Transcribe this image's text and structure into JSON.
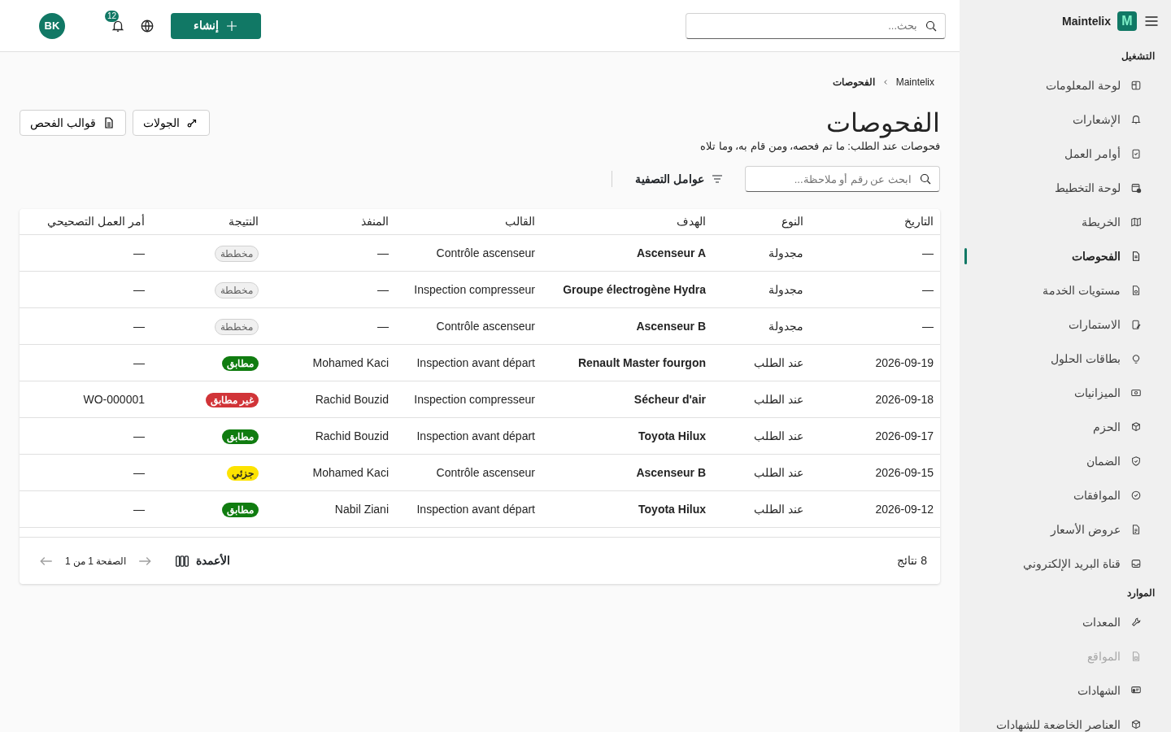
{
  "sidebar": {
    "brand": "Maintelix",
    "logo_letter": "M",
    "sections": [
      {
        "title": "التشغيل",
        "items": [
          {
            "label": "لوحة المعلومات",
            "selected": false,
            "disabled": false
          },
          {
            "label": "الإشعارات",
            "selected": false,
            "disabled": false
          },
          {
            "label": "أوامر العمل",
            "selected": false,
            "disabled": false
          },
          {
            "label": "لوحة التخطيط",
            "selected": false,
            "disabled": false
          },
          {
            "label": "الخريطة",
            "selected": false,
            "disabled": false
          },
          {
            "label": "الفحوصات",
            "selected": true,
            "disabled": false
          },
          {
            "label": "مستويات الخدمة",
            "selected": false,
            "disabled": false
          },
          {
            "label": "الاستمارات",
            "selected": false,
            "disabled": false
          },
          {
            "label": "بطاقات الحلول",
            "selected": false,
            "disabled": false
          },
          {
            "label": "الميزانيات",
            "selected": false,
            "disabled": false
          },
          {
            "label": "الحزم",
            "selected": false,
            "disabled": false
          },
          {
            "label": "الضمان",
            "selected": false,
            "disabled": false
          },
          {
            "label": "الموافقات",
            "selected": false,
            "disabled": false
          },
          {
            "label": "عروض الأسعار",
            "selected": false,
            "disabled": false
          },
          {
            "label": "قناة البريد الإلكتروني",
            "selected": false,
            "disabled": false
          }
        ]
      },
      {
        "title": "الموارد",
        "items": [
          {
            "label": "المعدات",
            "selected": false,
            "disabled": false
          },
          {
            "label": "المواقع",
            "selected": false,
            "disabled": true
          },
          {
            "label": "الشهادات",
            "selected": false,
            "disabled": false
          },
          {
            "label": "العناصر الخاضعة للشهادات",
            "selected": false,
            "disabled": false
          }
        ]
      }
    ]
  },
  "header": {
    "search": {
      "placeholder": "بحث..."
    },
    "create_button": "إنشاء",
    "notifications_count": "12",
    "avatar": "BK"
  },
  "breadcrumb": [
    "Maintelix",
    "الفحوصات"
  ],
  "title": "الفحوصات",
  "description": "فحوصات عند الطلب: ما تم فحصه، ومن قام به، وما تلاه",
  "actions": [
    "الجولات",
    "قوالب الفحص"
  ],
  "toolbar": {
    "search": {
      "placeholder": "ابحث عن رقم أو ملاحظة..."
    },
    "filters_button": "عوامل التصفية"
  },
  "table": {
    "columns": [
      "التاريخ",
      "النوع",
      "الهدف",
      "القالب",
      "المنفذ",
      "النتيجة",
      "أمر العمل التصحيحي"
    ],
    "rows": [
      {
        "date": "—",
        "type": "مجدولة",
        "target": "Ascenseur A",
        "template": "Contrôle ascenseur",
        "executor": "—",
        "result": {
          "label": "مخططة",
          "kind": "planned"
        },
        "work_order": "—"
      },
      {
        "date": "—",
        "type": "مجدولة",
        "target": "Groupe électrogène Hydra",
        "template": "Inspection compresseur",
        "executor": "—",
        "result": {
          "label": "مخططة",
          "kind": "planned"
        },
        "work_order": "—"
      },
      {
        "date": "—",
        "type": "مجدولة",
        "target": "Ascenseur B",
        "template": "Contrôle ascenseur",
        "executor": "—",
        "result": {
          "label": "مخططة",
          "kind": "planned"
        },
        "work_order": "—"
      },
      {
        "date": "2026-09-19",
        "type": "عند الطلب",
        "target": "Renault Master fourgon",
        "template": "Inspection avant départ",
        "executor": "Mohamed Kaci",
        "result": {
          "label": "مطابق",
          "kind": "pass"
        },
        "work_order": "—"
      },
      {
        "date": "2026-09-18",
        "type": "عند الطلب",
        "target": "Sécheur d'air",
        "template": "Inspection compresseur",
        "executor": "Rachid Bouzid",
        "result": {
          "label": "غير مطابق",
          "kind": "fail"
        },
        "work_order": "WO-000001"
      },
      {
        "date": "2026-09-17",
        "type": "عند الطلب",
        "target": "Toyota Hilux",
        "template": "Inspection avant départ",
        "executor": "Rachid Bouzid",
        "result": {
          "label": "مطابق",
          "kind": "pass"
        },
        "work_order": "—"
      },
      {
        "date": "2026-09-15",
        "type": "عند الطلب",
        "target": "Ascenseur B",
        "template": "Contrôle ascenseur",
        "executor": "Mohamed Kaci",
        "result": {
          "label": "جزئي",
          "kind": "partial"
        },
        "work_order": "—"
      },
      {
        "date": "2026-09-12",
        "type": "عند الطلب",
        "target": "Toyota Hilux",
        "template": "Inspection avant départ",
        "executor": "Nabil Ziani",
        "result": {
          "label": "مطابق",
          "kind": "pass"
        },
        "work_order": "—"
      }
    ]
  },
  "footer": {
    "count": "8 نتائج",
    "columns_button": "الأعمدة",
    "page_info": "الصفحة 1 من 1"
  }
}
